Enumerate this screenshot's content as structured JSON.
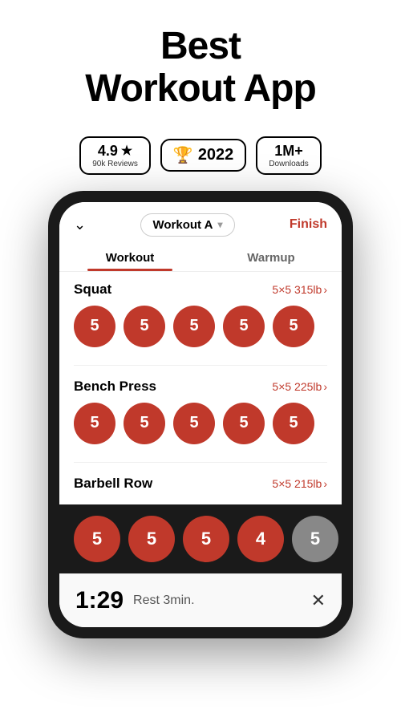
{
  "header": {
    "title_line1": "Best",
    "title_line2": "Workout App"
  },
  "badges": [
    {
      "id": "rating",
      "main": "4.9★",
      "sub": "90k Reviews"
    },
    {
      "id": "award",
      "main": "🏆 2022",
      "sub": null
    },
    {
      "id": "downloads",
      "main": "1M+",
      "sub": "Downloads"
    }
  ],
  "app": {
    "workout_name": "Workout A",
    "finish_label": "Finish",
    "tabs": [
      {
        "id": "workout",
        "label": "Workout",
        "active": true
      },
      {
        "id": "warmup",
        "label": "Warmup",
        "active": false
      }
    ],
    "exercises": [
      {
        "name": "Squat",
        "info": "5×5 315lb",
        "sets": [
          5,
          5,
          5,
          5,
          5
        ],
        "grey_index": -1
      },
      {
        "name": "Bench Press",
        "info": "5×5 225lb",
        "sets": [
          5,
          5,
          5,
          5,
          5
        ],
        "grey_index": -1
      },
      {
        "name": "Barbell Row",
        "info": "5×5 215lb",
        "sets": [
          5,
          5,
          5,
          4,
          5
        ],
        "grey_index": 4
      }
    ],
    "rest_timer": {
      "time": "1:29",
      "label": "Rest 3min."
    }
  },
  "icons": {
    "chevron_down": "⌄",
    "dropdown_arrow": "▾",
    "close": "✕",
    "trophy": "🏆"
  }
}
